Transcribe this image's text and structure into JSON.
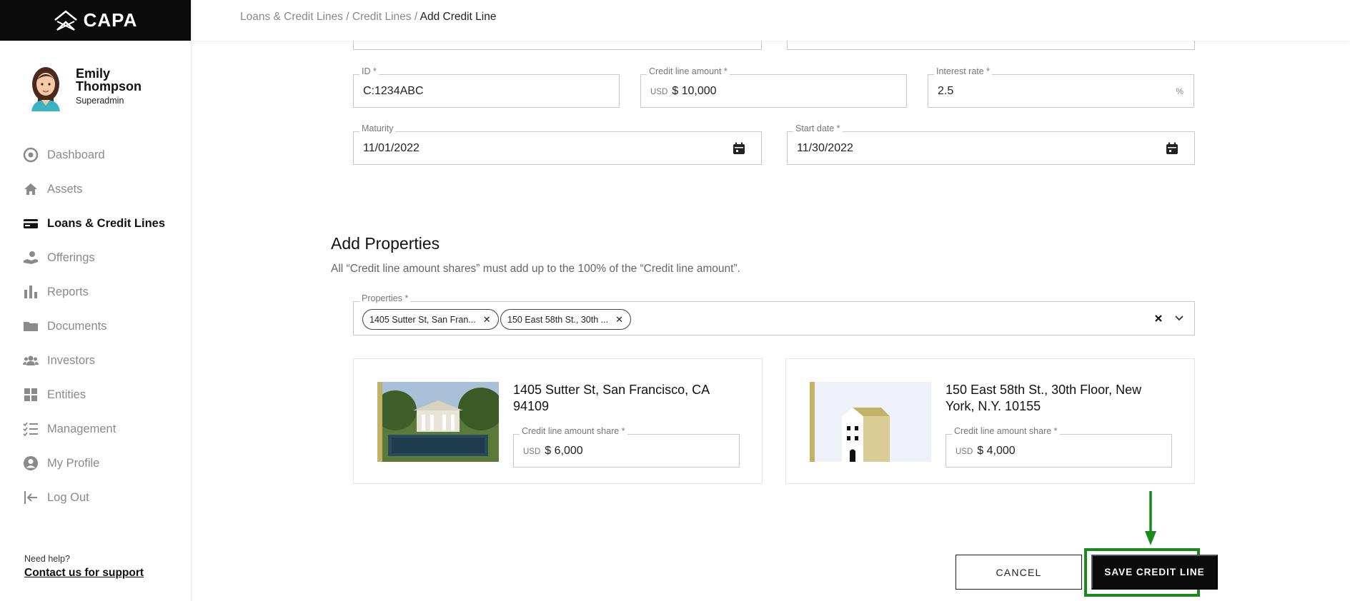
{
  "app": {
    "logo_text": "CAPA"
  },
  "user": {
    "name": "Emily Thompson",
    "role": "Superadmin"
  },
  "nav": [
    {
      "label": "Dashboard",
      "icon": "dashboard-icon",
      "active": false
    },
    {
      "label": "Assets",
      "icon": "home-icon",
      "active": false
    },
    {
      "label": "Loans & Credit Lines",
      "icon": "credit-card-icon",
      "active": true
    },
    {
      "label": "Offerings",
      "icon": "hand-coin-icon",
      "active": false
    },
    {
      "label": "Reports",
      "icon": "bar-chart-icon",
      "active": false
    },
    {
      "label": "Documents",
      "icon": "folder-icon",
      "active": false
    },
    {
      "label": "Investors",
      "icon": "users-icon",
      "active": false
    },
    {
      "label": "Entities",
      "icon": "grid-icon",
      "active": false
    },
    {
      "label": "Management",
      "icon": "checklist-icon",
      "active": false
    },
    {
      "label": "My Profile",
      "icon": "user-circle-icon",
      "active": false
    },
    {
      "label": "Log Out",
      "icon": "logout-icon",
      "active": false
    }
  ],
  "help": {
    "question": "Need help?",
    "link": "Contact us for support"
  },
  "breadcrumb": {
    "items": [
      "Loans & Credit Lines",
      "Credit Lines"
    ],
    "separator": "/",
    "current": "Add Credit Line"
  },
  "form": {
    "id": {
      "label": "ID *",
      "value": "C:1234ABC"
    },
    "credit_amount": {
      "label": "Credit line amount *",
      "prefix": "USD",
      "value": "$ 10,000"
    },
    "interest_rate": {
      "label": "Interest rate *",
      "value": "2.5",
      "suffix": "%"
    },
    "maturity": {
      "label": "Maturity",
      "value": "11/01/2022"
    },
    "start_date": {
      "label": "Start date *",
      "value": "11/30/2022"
    }
  },
  "properties_section": {
    "title": "Add Properties",
    "description": "All “Credit line amount shares” must add up to the 100% of the “Credit line amount”.",
    "select_label": "Properties *",
    "chips": [
      "1405 Sutter St, San Fran...",
      "150 East 58th St., 30th ..."
    ],
    "cards": [
      {
        "title": "1405 Sutter St, San Francisco, CA 94109",
        "share_label": "Credit line amount share *",
        "prefix": "USD",
        "value": "$ 6,000"
      },
      {
        "title": "150 East 58th St., 30th Floor, New York, N.Y. 10155",
        "share_label": "Credit line amount share *",
        "prefix": "USD",
        "value": "$ 4,000"
      }
    ]
  },
  "actions": {
    "cancel": "CANCEL",
    "save": "SAVE CREDIT LINE"
  },
  "colors": {
    "accent_gold": "#c2b266",
    "highlight_green": "#1a8a1a",
    "dark": "#0b0b0b"
  }
}
